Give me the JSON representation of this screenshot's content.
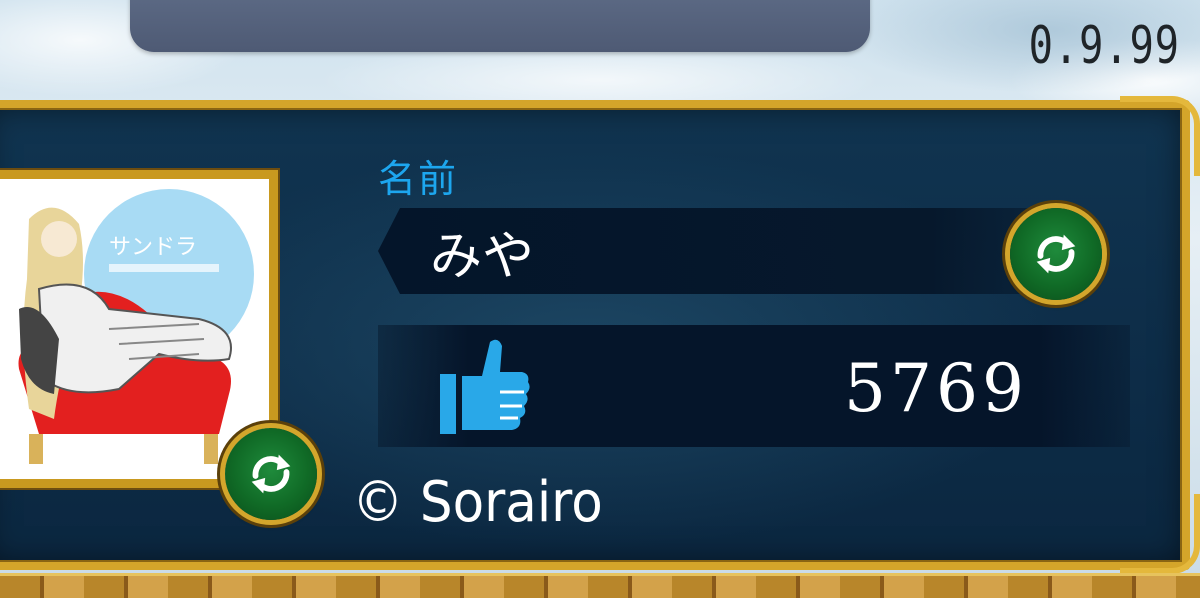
{
  "version": "0.9.99",
  "profile": {
    "name_label": "名前",
    "name_value": "みや",
    "likes_count": "5769",
    "copyright": "© Sorairo"
  },
  "portrait": {
    "title_text": "サンドラ"
  },
  "icons": {
    "refresh_portrait": "refresh-icon",
    "refresh_name": "refresh-icon",
    "likes": "thumbs-up-icon"
  },
  "colors": {
    "label_blue": "#1da6ee",
    "gold_frame": "#d4a52a",
    "panel_navy": "#0d2c47",
    "button_green": "#106a26",
    "thumb_blue": "#29a8e8"
  }
}
